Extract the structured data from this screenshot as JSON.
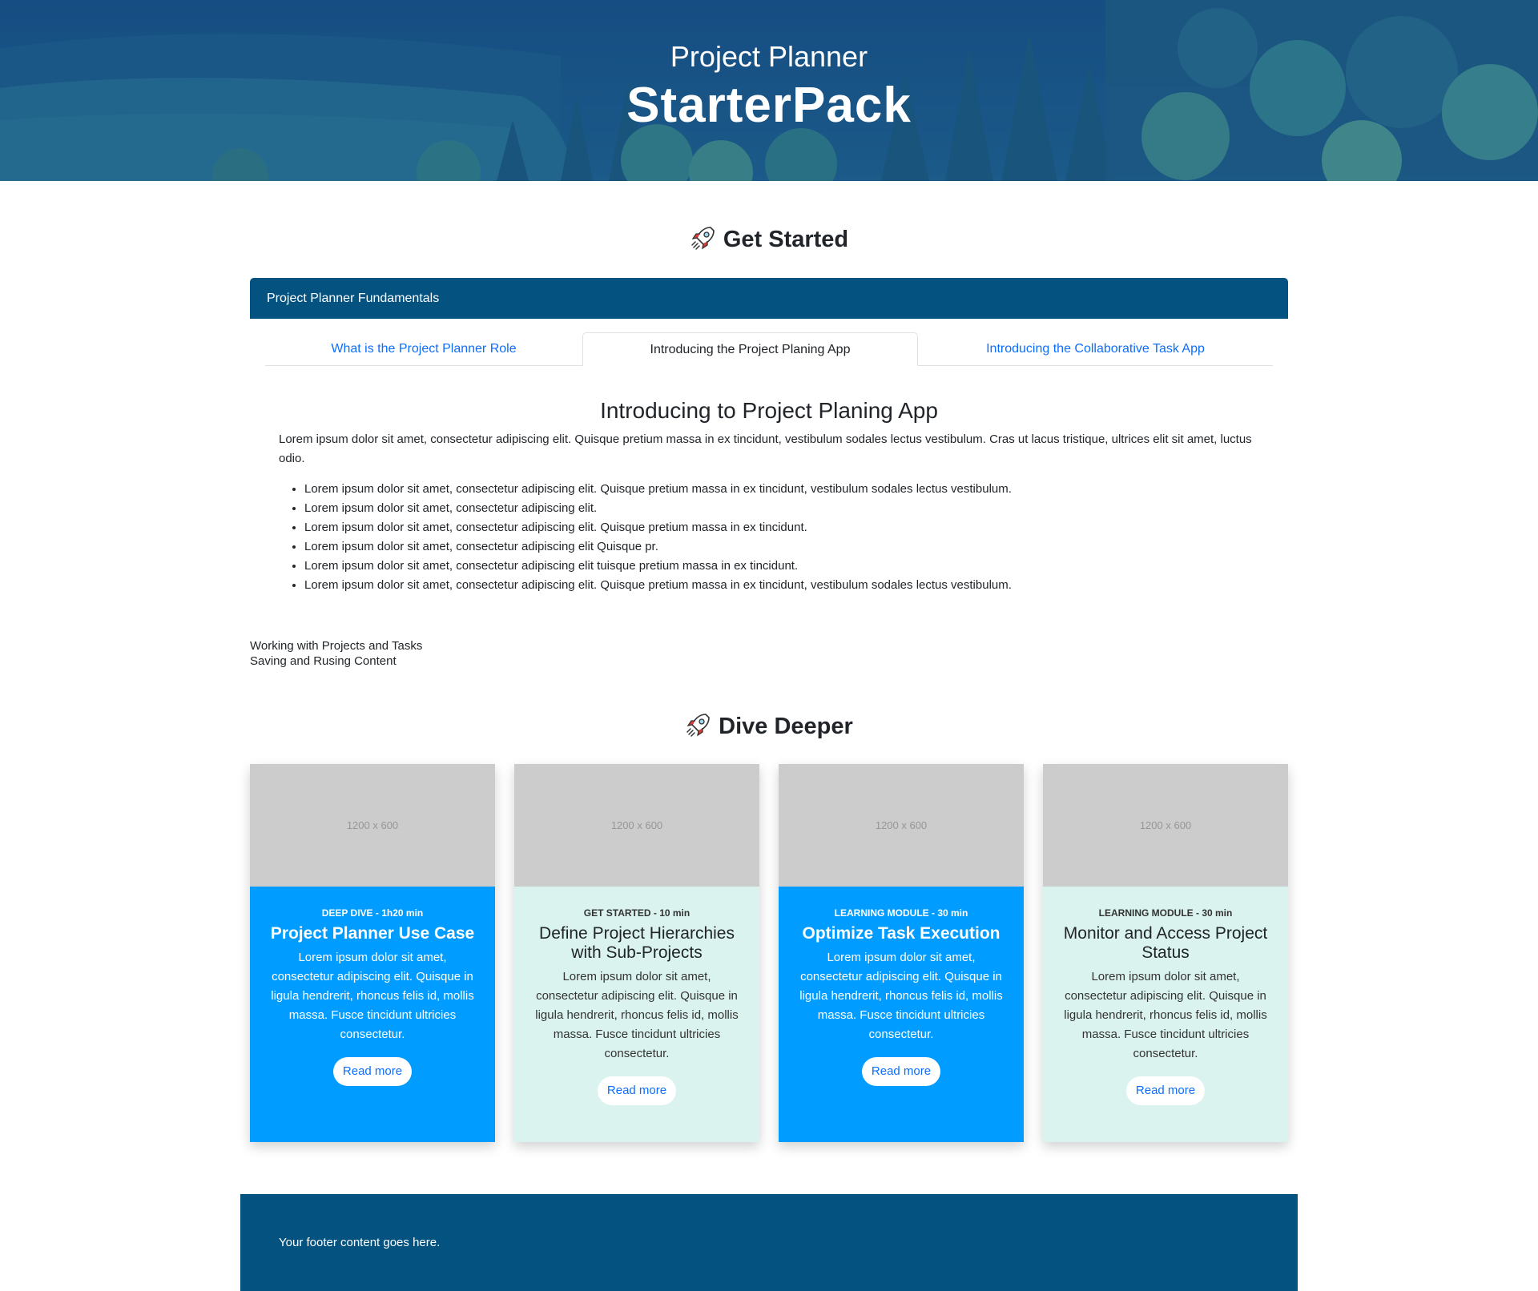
{
  "hero": {
    "subtitle": "Project Planner",
    "title": "StarterPack"
  },
  "get_started": {
    "heading": "Get Started",
    "icon": "rocket-icon",
    "accordion": {
      "header": "Project Planner Fundamentals",
      "tabs": [
        {
          "label": "What is the Project Planner Role",
          "active": false
        },
        {
          "label": "Introducing the Project Planing App",
          "active": true
        },
        {
          "label": "Introducing the Collaborative Task App",
          "active": false
        }
      ],
      "content": {
        "title": "Introducing to Project Planing App",
        "intro": "Lorem ipsum dolor sit amet, consectetur adipiscing elit. Quisque pretium massa in ex tincidunt, vestibulum sodales lectus vestibulum. Cras ut lacus tristique, ultrices elit sit amet, luctus odio.",
        "bullets": [
          "Lorem ipsum dolor sit amet, consectetur adipiscing elit. Quisque pretium massa in ex tincidunt, vestibulum sodales lectus vestibulum.",
          "Lorem ipsum dolor sit amet, consectetur adipiscing elit.",
          "Lorem ipsum dolor sit amet, consectetur adipiscing elit. Quisque pretium massa in ex tincidunt.",
          "Lorem ipsum dolor sit amet, consectetur adipiscing elit Quisque pr.",
          "Lorem ipsum dolor sit amet, consectetur adipiscing elit tuisque pretium massa in ex tincidunt.",
          "Lorem ipsum dolor sit amet, consectetur adipiscing elit. Quisque pretium massa in ex tincidunt, vestibulum sodales lectus vestibulum."
        ]
      }
    },
    "links": [
      "Working with Projects and Tasks",
      "Saving and Rusing Content"
    ]
  },
  "dive_deeper": {
    "heading": "Dive Deeper",
    "icon": "rocket-icon",
    "cards": [
      {
        "image_placeholder": "1200 x 600",
        "meta": "DEEP DIVE - 1h20 min",
        "title": "Project Planner Use Case",
        "description": "Lorem ipsum dolor sit amet, consectetur adipiscing elit. Quisque in ligula hendrerit, rhoncus felis id, mollis massa. Fusce tincidunt ultricies consectetur.",
        "button": "Read more",
        "theme": "blue"
      },
      {
        "image_placeholder": "1200 x 600",
        "meta": "GET STARTED - 10 min",
        "title": "Define Project Hierarchies with Sub-Projects",
        "description": "Lorem ipsum dolor sit amet, consectetur adipiscing elit. Quisque in ligula hendrerit, rhoncus felis id, mollis massa. Fusce tincidunt ultricies consectetur.",
        "button": "Read more",
        "theme": "mint"
      },
      {
        "image_placeholder": "1200 x 600",
        "meta": "LEARNING MODULE - 30 min",
        "title": "Optimize Task Execution",
        "description": "Lorem ipsum dolor sit amet, consectetur adipiscing elit. Quisque in ligula hendrerit, rhoncus felis id, mollis massa. Fusce tincidunt ultricies consectetur.",
        "button": "Read more",
        "theme": "blue"
      },
      {
        "image_placeholder": "1200 x 600",
        "meta": "LEARNING MODULE - 30 min",
        "title": "Monitor and Access Project Status",
        "description": "Lorem ipsum dolor sit amet, consectetur adipiscing elit. Quisque in ligula hendrerit, rhoncus felis id, mollis massa. Fusce tincidunt ultricies consectetur.",
        "button": "Read more",
        "theme": "mint"
      }
    ]
  },
  "footer": {
    "text": "Your footer content goes here."
  },
  "colors": {
    "primary_dark": "#04527f",
    "card_blue": "#009cff",
    "card_mint": "#daf3ef",
    "link": "#0d6efd",
    "placeholder_gray": "#cccccc"
  }
}
